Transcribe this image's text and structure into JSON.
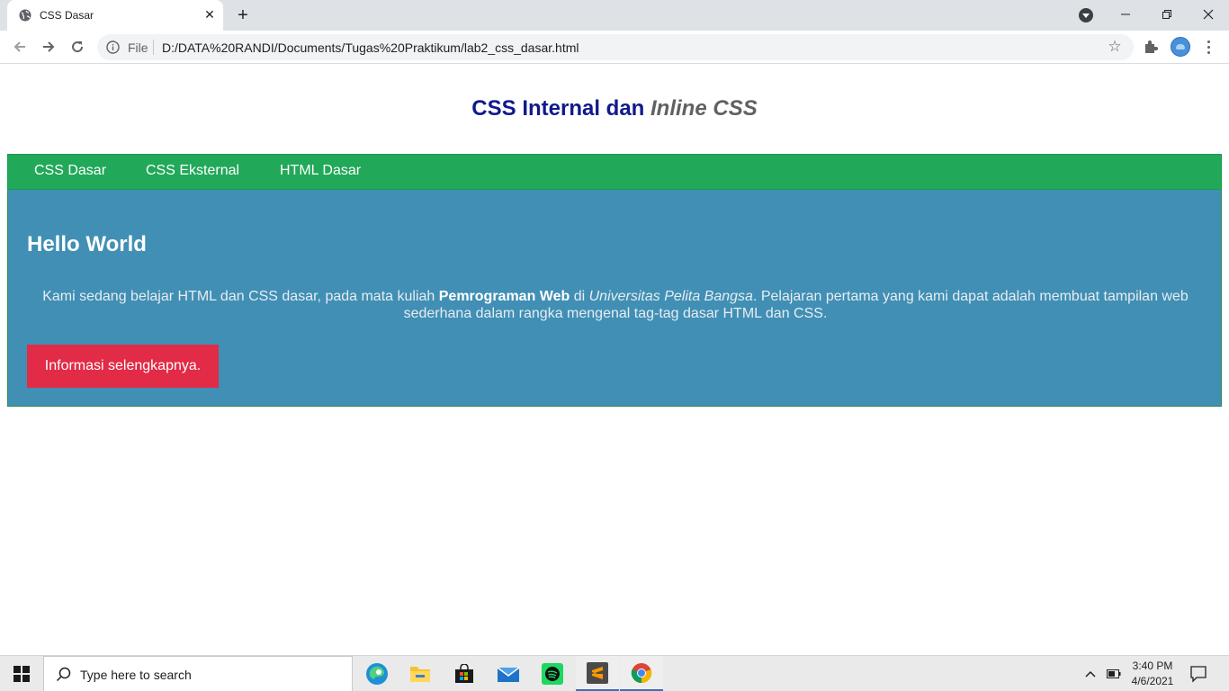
{
  "browser": {
    "tab_title": "CSS Dasar",
    "url_scheme_label": "File",
    "url": "D:/DATA%20RANDI/Documents/Tugas%20Praktikum/lab2_css_dasar.html"
  },
  "page": {
    "title_bold": "CSS Internal dan",
    "title_em": "Inline CSS",
    "nav": [
      "CSS Dasar",
      "CSS Eksternal",
      "HTML Dasar"
    ],
    "hero": {
      "heading": "Hello World",
      "text_1": "Kami sedang belajar HTML dan CSS dasar, pada mata kuliah ",
      "text_bold": "Pemrograman Web",
      "text_2": " di ",
      "text_italic": "Universitas Pelita Bangsa",
      "text_3": ". Pelajaran pertama yang kami dapat adalah membuat tampilan web sederhana dalam rangka mengenal tag-tag dasar HTML dan CSS.",
      "button": "Informasi selengkapnya."
    },
    "colors": {
      "nav_bg": "#21a858",
      "hero_bg": "#418fb4",
      "button_bg": "#e22b46",
      "title": "#10198c"
    }
  },
  "taskbar": {
    "search_placeholder": "Type here to search",
    "time": "3:40 PM",
    "date": "4/6/2021",
    "apps": [
      "edge-icon",
      "file-explorer-icon",
      "store-icon",
      "mail-icon",
      "spotify-icon",
      "sublime-text-icon",
      "chrome-icon"
    ]
  }
}
